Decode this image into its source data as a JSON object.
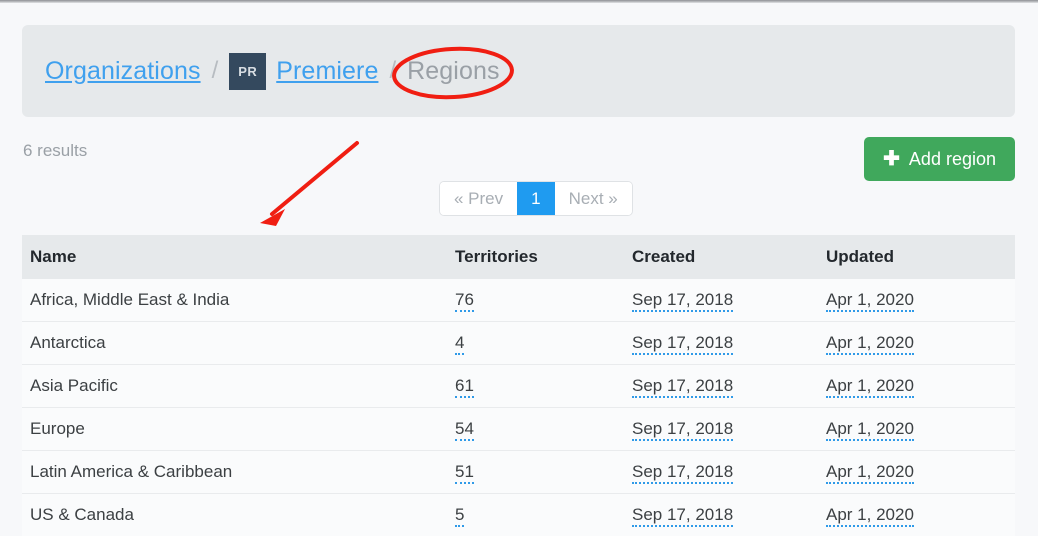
{
  "breadcrumb": {
    "organizations_label": "Organizations",
    "separator": "/",
    "org_badge": "PR",
    "org_name": "Premiere",
    "current_label": "Regions"
  },
  "toolbar": {
    "results_text": "6 results",
    "add_button_label": "Add region",
    "add_button_icon": "plus-icon",
    "add_button_color": "#40a85c"
  },
  "pagination": {
    "prev_label": "« Prev",
    "current_page": "1",
    "next_label": "Next »",
    "active_color": "#1f9bf0"
  },
  "table": {
    "headers": {
      "name": "Name",
      "territories": "Territories",
      "created": "Created",
      "updated": "Updated"
    },
    "rows": [
      {
        "name": "Africa, Middle East & India",
        "territories": "76",
        "created": "Sep 17, 2018",
        "updated": "Apr 1, 2020"
      },
      {
        "name": "Antarctica",
        "territories": "4",
        "created": "Sep 17, 2018",
        "updated": "Apr 1, 2020"
      },
      {
        "name": "Asia Pacific",
        "territories": "61",
        "created": "Sep 17, 2018",
        "updated": "Apr 1, 2020"
      },
      {
        "name": "Europe",
        "territories": "54",
        "created": "Sep 17, 2018",
        "updated": "Apr 1, 2020"
      },
      {
        "name": "Latin America & Caribbean",
        "territories": "51",
        "created": "Sep 17, 2018",
        "updated": "Apr 1, 2020"
      },
      {
        "name": "US & Canada",
        "territories": "5",
        "created": "Sep 17, 2018",
        "updated": "Apr 1, 2020"
      }
    ]
  },
  "annotations": {
    "highlight_color": "#f01e12",
    "ellipse_target": "Regions",
    "arrow_points_to": "pagination"
  }
}
